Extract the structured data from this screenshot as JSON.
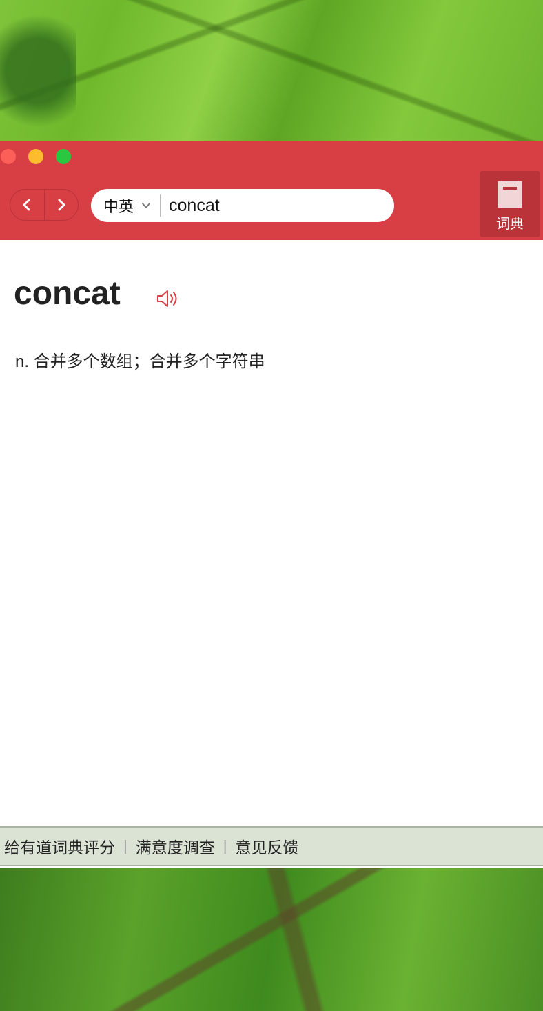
{
  "window": {
    "accent_color": "#d83f44",
    "traffic_lights": [
      "close",
      "minimize",
      "maximize"
    ]
  },
  "toolbar": {
    "back_icon": "chevron-left-icon",
    "forward_icon": "chevron-right-icon",
    "language_selected": "中英",
    "search_value": "concat",
    "dict_button_label": "词典",
    "dict_icon": "book-icon"
  },
  "result": {
    "word": "concat",
    "speaker_icon": "speaker-icon",
    "definition": "n. 合并多个数组；合并多个字符串"
  },
  "footer": {
    "links": [
      "给有道词典评分",
      "满意度调查",
      "意见反馈"
    ],
    "separator": "|"
  }
}
